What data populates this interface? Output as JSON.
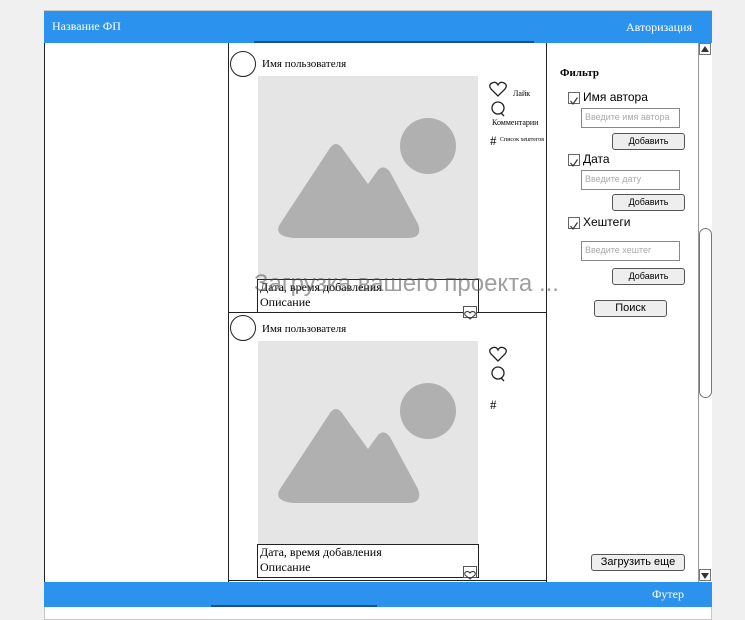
{
  "header": {
    "app_title": "Название ФП",
    "auth_link": "Авторизация"
  },
  "footer": {
    "label": "Футер"
  },
  "posts": [
    {
      "username": "Имя пользователя",
      "actions": {
        "like": "Лайк",
        "comments": "Комментарии",
        "hashtags": "Список хештегов"
      },
      "date_line": "Дата, время добавления",
      "description": "Описание"
    },
    {
      "username": "Имя пользователя",
      "date_line": "Дата, время добавления",
      "description": "Описание"
    }
  ],
  "filter": {
    "title": "Фильтр",
    "author": {
      "label": "Имя автора",
      "checked": true,
      "placeholder": "Введите имя автора",
      "add_label": "Добавить"
    },
    "date": {
      "label": "Дата",
      "checked": true,
      "placeholder": "Введите дату",
      "add_label": "Добавить"
    },
    "hashtags": {
      "label": "Хештеги",
      "checked": true,
      "placeholder": "Введите хештег",
      "add_label": "Добавить"
    },
    "search_label": "Поиск"
  },
  "load_more_label": "Загрузить еще",
  "loading_overlay": "Загрузка вашего проекта ...",
  "colors": {
    "header_blue": "#2b93ee",
    "tab_indicator": "#1a4f9a",
    "image_placeholder": "#e5e5e5",
    "image_shape": "#b0b0b0"
  }
}
